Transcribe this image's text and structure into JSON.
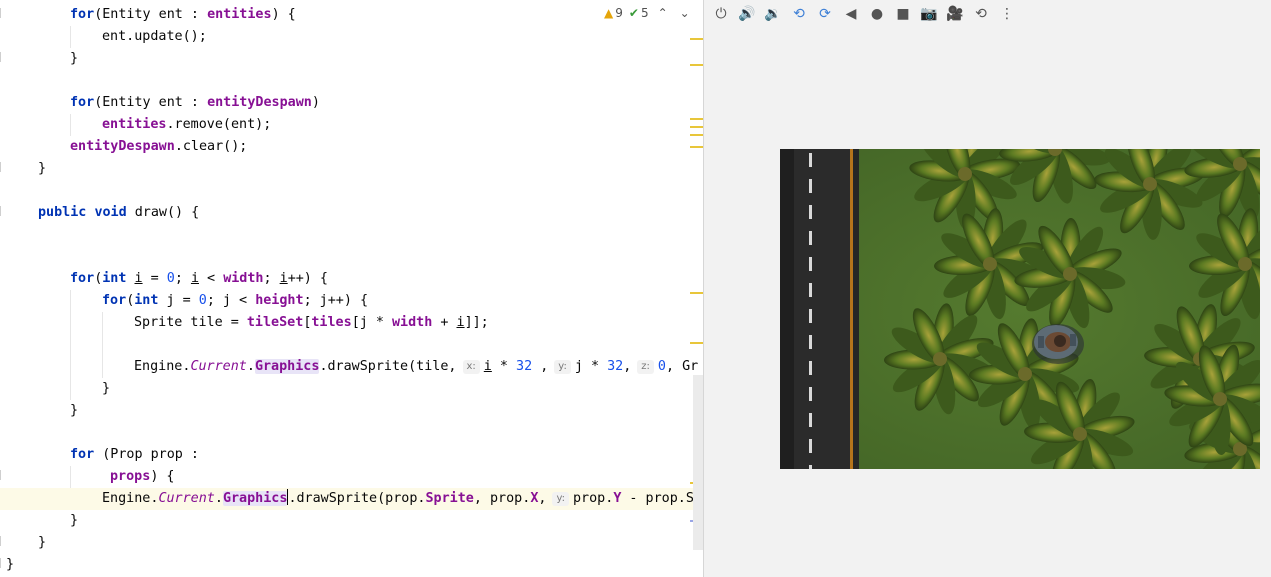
{
  "editor": {
    "inspection": {
      "warnings": "9",
      "weak_warnings": "5"
    },
    "lines": {
      "l1": [
        "for",
        "(Entity ent : ",
        "entities",
        ") {"
      ],
      "l2": [
        "ent.update();"
      ],
      "l3": [
        "}"
      ],
      "l5": [
        "for",
        "(Entity ent : ",
        "entityDespawn",
        ")"
      ],
      "l6": [
        "entities",
        ".remove(ent);"
      ],
      "l7": [
        "entityDespawn",
        ".clear();"
      ],
      "l8": [
        "}"
      ],
      "l10": [
        "public",
        " ",
        "void",
        " draw() {"
      ],
      "l13": [
        "for",
        "(",
        "int",
        " ",
        "i",
        " = ",
        "0",
        "; ",
        "i",
        " < ",
        "width",
        "; ",
        "i",
        "++) {"
      ],
      "l14": [
        "for",
        "(",
        "int",
        " j = ",
        "0",
        "; j < ",
        "height",
        "; j++) {"
      ],
      "l15": [
        "Sprite tile = ",
        "tileSet",
        "[",
        "tiles",
        "[j * ",
        "width",
        " + ",
        "i",
        "]];"
      ],
      "l17": [
        "Engine.",
        "Current",
        ".",
        "Graphics",
        ".drawSprite(tile,",
        "x:",
        "i",
        " * ",
        "32",
        " ,",
        "y:",
        "j * ",
        "32",
        ",",
        "z:",
        "0",
        ", Gr"
      ],
      "l18": [
        "}"
      ],
      "l19": [
        "}"
      ],
      "l21": [
        "for",
        " (Prop prop :"
      ],
      "l22": [
        "props",
        ") {"
      ],
      "l23": [
        "Engine.",
        "Current",
        ".",
        "Graphics",
        ".drawSprite(prop.",
        "Sprite",
        ", prop.",
        "X",
        ",",
        "y:",
        "prop.",
        "Y",
        " - prop.Spr"
      ],
      "l24": [
        "}"
      ],
      "l25": [
        "}"
      ],
      "l26": [
        "}"
      ]
    }
  },
  "emulator": {
    "toolbar": [
      {
        "icon": "power-icon",
        "glyph": "⏻"
      },
      {
        "icon": "volume-up-icon",
        "glyph": "🔊"
      },
      {
        "icon": "volume-down-icon",
        "glyph": "🔉"
      },
      {
        "icon": "rotate-left-icon",
        "glyph": "⟲"
      },
      {
        "icon": "rotate-right-icon",
        "glyph": "⟳"
      },
      {
        "icon": "back-icon",
        "glyph": "◀"
      },
      {
        "icon": "home-icon",
        "glyph": "●"
      },
      {
        "icon": "overview-icon",
        "glyph": "■"
      },
      {
        "icon": "camera-icon",
        "glyph": "📷"
      },
      {
        "icon": "screen-record-icon",
        "glyph": "🎥"
      },
      {
        "icon": "snapshot-icon",
        "glyph": "⟲"
      },
      {
        "icon": "more-icon",
        "glyph": "⋮"
      }
    ],
    "colors": {
      "grass": "#4b6d2a",
      "road": "#2b2b2b",
      "road_edge": "#b5741c",
      "lane_marking": "#d9d9d9",
      "palm_dark": "#3d5a1c",
      "palm_light": "#8a9a2c"
    }
  }
}
